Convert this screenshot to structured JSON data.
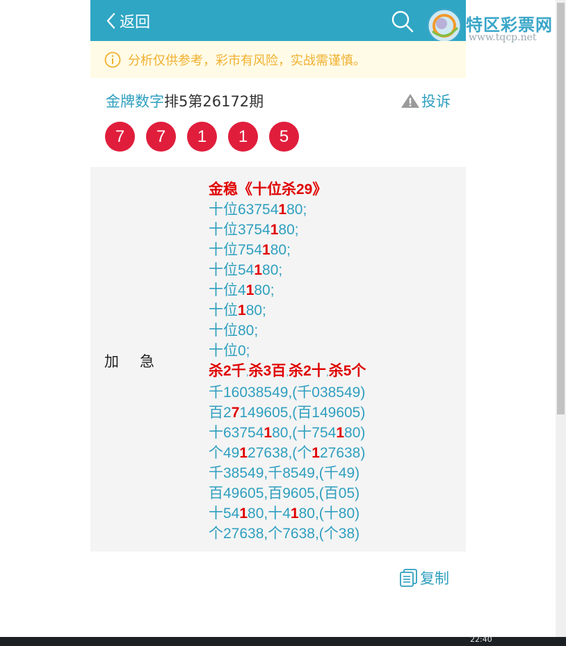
{
  "header": {
    "back_label": "返回",
    "icons": [
      "chevron-left-icon",
      "search-icon"
    ],
    "bar_color": "#2fa6c4"
  },
  "logo": {
    "name": "特区彩票网",
    "url": "www.tqcp.net"
  },
  "notice": {
    "icon": "info-icon",
    "text": "分析仅供参考，彩市有风险，实战需谨慎。"
  },
  "article": {
    "title_link": "金牌数字",
    "title_rest": "排5第26172期",
    "complain_label": "投诉",
    "complain_icon": "warning-icon"
  },
  "numbers": [
    "7",
    "7",
    "1",
    "1",
    "5"
  ],
  "panel": {
    "tag": "加急",
    "heading": "金稳《十位杀29》",
    "tenth_lines": [
      {
        "pre": "十位63754",
        "hl": "1",
        "post": "80;"
      },
      {
        "pre": "十位3754",
        "hl": "1",
        "post": "80;"
      },
      {
        "pre": "十位754",
        "hl": "1",
        "post": "80;"
      },
      {
        "pre": "十位54",
        "hl": "1",
        "post": "80;"
      },
      {
        "pre": "十位4",
        "hl": "1",
        "post": "80;"
      },
      {
        "pre": "十位",
        "hl": "1",
        "post": "80;"
      },
      {
        "pre": "十位80;",
        "hl": "",
        "post": ""
      },
      {
        "pre": "十位0;",
        "hl": "",
        "post": ""
      }
    ],
    "kill_labels": [
      "杀2千",
      "杀3百",
      "杀2十",
      "杀5个"
    ],
    "kill_separator": ",",
    "kill_lines": [
      {
        "a": "千16038549,(千038549)",
        "b": "",
        "c": "",
        "d": "",
        "e": ""
      },
      {
        "a": "百2",
        "b": "7",
        "c": "149605,(百149605)",
        "d": "",
        "e": ""
      },
      {
        "a": "十63754",
        "b": "1",
        "c": "80,(十754",
        "d": "1",
        "e": "80)"
      },
      {
        "a": "个49",
        "b": "1",
        "c": "27638,(个",
        "d": "1",
        "e": "27638)"
      },
      {
        "a": "千38549,千8549,(千49)",
        "b": "",
        "c": "",
        "d": "",
        "e": ""
      },
      {
        "a": "百49605,百9605,(百05)",
        "b": "",
        "c": "",
        "d": "",
        "e": ""
      },
      {
        "a": "十54",
        "b": "1",
        "c": "80,十4",
        "d": "1",
        "e": "80,(十80)"
      },
      {
        "a": "个27638,个7638,(个38)",
        "b": "",
        "c": "",
        "d": "",
        "e": ""
      }
    ]
  },
  "copy": {
    "label": "复制",
    "icon": "copy-icon"
  },
  "taskbar": {
    "clock": "22:40"
  },
  "colors": {
    "ball": "#e01e3c",
    "link": "#2f9fbf",
    "highlight": "#e00000",
    "notice_bg": "#fffbe6",
    "notice_text": "#f0b030"
  }
}
